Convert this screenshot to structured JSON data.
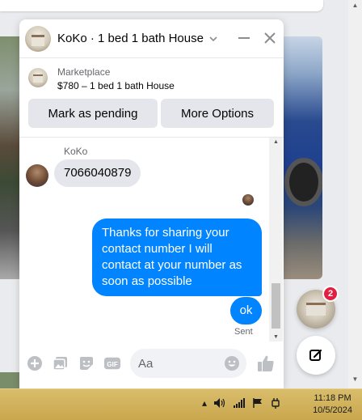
{
  "chat": {
    "title": "KoKo · 1 bed 1 bath House",
    "listing": {
      "label": "Marketplace",
      "price_title": "$780 – 1 bed 1 bath House"
    },
    "buttons": {
      "pending": "Mark as pending",
      "more": "More Options"
    },
    "messages": {
      "sender_name": "KoKo",
      "incoming": "7066040879",
      "outgoing_long": "Thanks for sharing your contact number I will contact at your number as soon as possible",
      "outgoing_short": "ok",
      "status": "Sent"
    },
    "composer": {
      "placeholder": "Aa",
      "gif_label": "GIF"
    }
  },
  "badge": {
    "count": "2"
  },
  "taskbar": {
    "time": "11:18 PM",
    "date": "10/5/2024"
  },
  "colors": {
    "accent": "#0084ff",
    "badge": "#e41e3f",
    "taskbar": "#c9a74e"
  }
}
